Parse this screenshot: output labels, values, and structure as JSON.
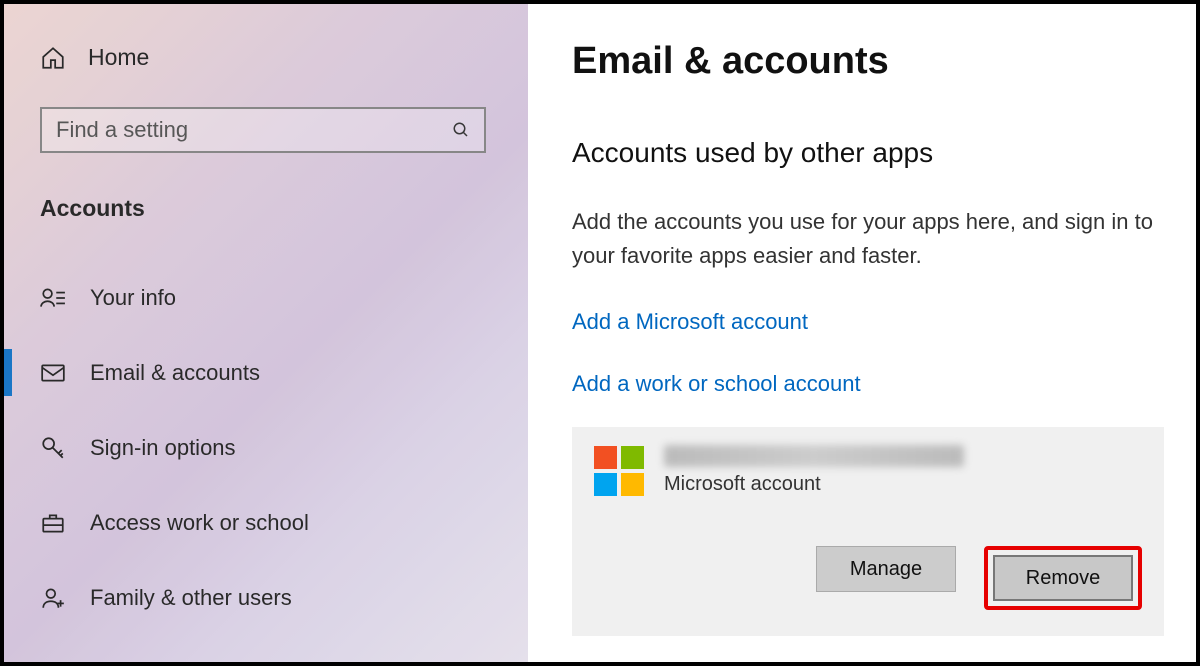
{
  "sidebar": {
    "home_label": "Home",
    "search_placeholder": "Find a setting",
    "section_title": "Accounts",
    "items": [
      {
        "label": "Your info",
        "icon": "person-lines",
        "selected": false
      },
      {
        "label": "Email & accounts",
        "icon": "mail",
        "selected": true
      },
      {
        "label": "Sign-in options",
        "icon": "key",
        "selected": false
      },
      {
        "label": "Access work or school",
        "icon": "briefcase",
        "selected": false
      },
      {
        "label": "Family & other users",
        "icon": "person-add",
        "selected": false
      }
    ]
  },
  "main": {
    "page_title": "Email & accounts",
    "subheading": "Accounts used by other apps",
    "description": "Add the accounts you use for your apps here, and sign in to your favorite apps easier and faster.",
    "link_add_ms": "Add a Microsoft account",
    "link_add_work": "Add a work or school account",
    "account": {
      "email_redacted": "",
      "type_label": "Microsoft account"
    },
    "buttons": {
      "manage": "Manage",
      "remove": "Remove"
    }
  },
  "colors": {
    "accent": "#0067c0",
    "highlight": "#e60000"
  }
}
